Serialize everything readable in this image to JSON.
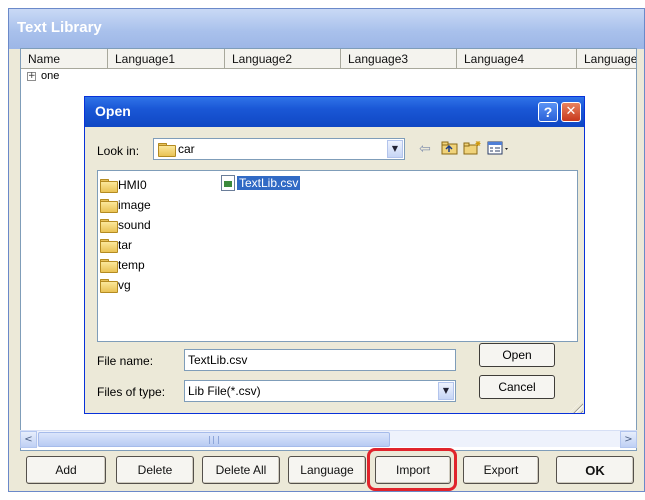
{
  "main": {
    "title": "Text Library",
    "columns": [
      "Name",
      "Language1",
      "Language2",
      "Language3",
      "Language4",
      "Language"
    ],
    "tree": {
      "expand": "+",
      "label": "one"
    },
    "buttons": {
      "add": "Add",
      "delete": "Delete",
      "delete_all": "Delete All",
      "language": "Language",
      "import": "Import",
      "export": "Export",
      "ok": "OK"
    },
    "scroll_left": "<",
    "scroll_right": ">"
  },
  "dialog": {
    "title": "Open",
    "help": "?",
    "close": "✕",
    "look_in_label": "Look in:",
    "look_in_value": "car",
    "dropdown_arrow": "▼",
    "toolbar_icons": [
      "back-arrow-icon",
      "up-folder-icon",
      "new-folder-icon",
      "view-menu-icon"
    ],
    "folders": [
      "HMI0",
      "image",
      "sound",
      "tar",
      "temp",
      "vg"
    ],
    "selected_file": "TextLib.csv",
    "file_name_label": "File name:",
    "file_name_value": "TextLib.csv",
    "file_type_label": "Files of type:",
    "file_type_value": "Lib File(*.csv)",
    "open_button": "Open",
    "cancel_button": "Cancel"
  },
  "colors": {
    "highlight": "#e0242c",
    "dialog_titlebar": "#0f47c4",
    "selection": "#316ac5"
  }
}
